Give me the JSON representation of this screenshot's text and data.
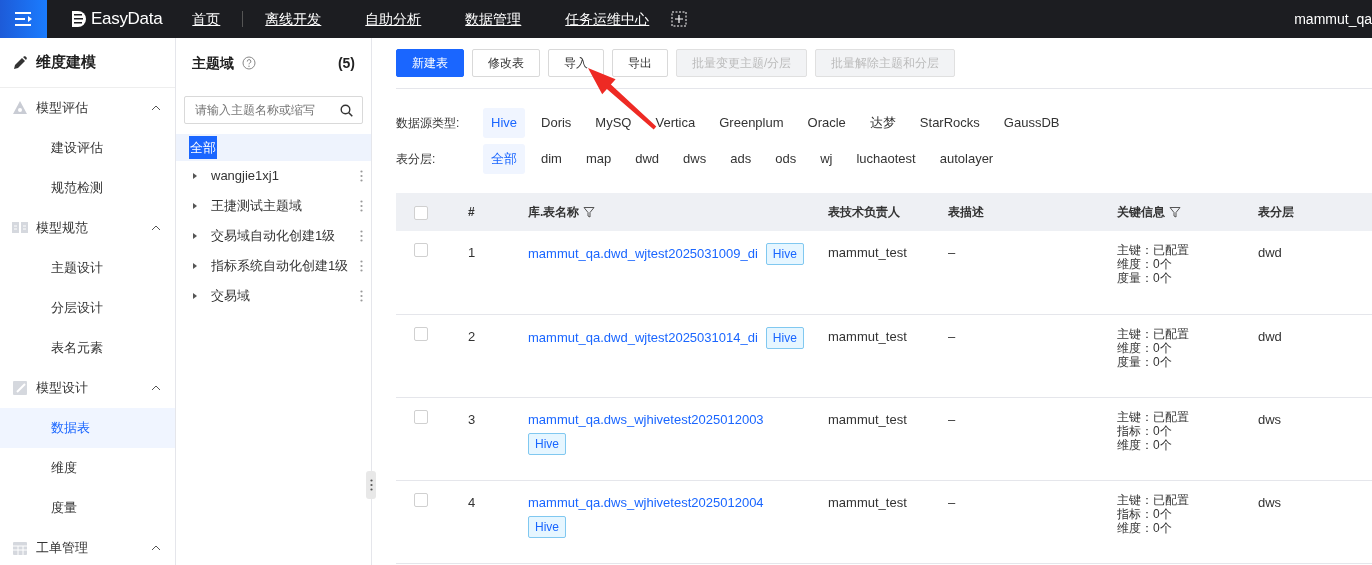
{
  "topbar": {
    "logo": "EasyData",
    "nav": [
      {
        "label": "首页"
      },
      {
        "label": "离线开发"
      },
      {
        "label": "自助分析"
      },
      {
        "label": "数据管理"
      },
      {
        "label": "任务运维中心"
      }
    ],
    "user": "mammut_qa"
  },
  "sidebar": {
    "title": "维度建模",
    "groups": [
      {
        "label": "模型评估",
        "expanded": true,
        "children": [
          {
            "label": "建设评估",
            "selected": false
          },
          {
            "label": "规范检测",
            "selected": false
          }
        ]
      },
      {
        "label": "模型规范",
        "expanded": true,
        "children": [
          {
            "label": "主题设计",
            "selected": false
          },
          {
            "label": "分层设计",
            "selected": false
          },
          {
            "label": "表名元素",
            "selected": false
          }
        ]
      },
      {
        "label": "模型设计",
        "expanded": true,
        "children": [
          {
            "label": "数据表",
            "selected": true
          },
          {
            "label": "维度",
            "selected": false
          },
          {
            "label": "度量",
            "selected": false
          }
        ]
      },
      {
        "label": "工单管理",
        "expanded": true
      }
    ]
  },
  "tree": {
    "title": "主题域",
    "count": "(5)",
    "search": {
      "placeholder": "请输入主题名称或缩写"
    },
    "all": {
      "label": "全部",
      "selected": true
    },
    "items": [
      {
        "label": "wangjie1xj1",
        "expanded": false
      },
      {
        "label": "王捷测试主题域",
        "expanded": false
      },
      {
        "label": "交易域自动化创建1级",
        "expanded": false
      },
      {
        "label": "指标系统自动化创建1级",
        "expanded": false
      },
      {
        "label": "交易域",
        "expanded": false
      }
    ]
  },
  "toolbar": [
    {
      "label": "新建表",
      "kind": "primary",
      "disabled": false
    },
    {
      "label": "修改表",
      "kind": "default",
      "disabled": false
    },
    {
      "label": "导入",
      "kind": "default",
      "disabled": false
    },
    {
      "label": "导出",
      "kind": "default",
      "disabled": false
    },
    {
      "label": "批量变更主题/分层",
      "kind": "default",
      "disabled": true
    },
    {
      "label": "批量解除主题和分层",
      "kind": "default",
      "disabled": true
    }
  ],
  "filters": [
    {
      "label": "数据源类型:",
      "options": [
        {
          "label": "Hive",
          "selected": true
        },
        {
          "label": "Doris",
          "selected": false
        },
        {
          "label": "MySQ",
          "selected": false
        },
        {
          "label": "Vertica",
          "selected": false
        },
        {
          "label": "Greenplum",
          "selected": false
        },
        {
          "label": "Oracle",
          "selected": false
        },
        {
          "label": "达梦",
          "selected": false
        },
        {
          "label": "StarRocks",
          "selected": false
        },
        {
          "label": "GaussDB",
          "selected": false
        }
      ]
    },
    {
      "label": "表分层:",
      "options": [
        {
          "label": "全部",
          "selected": true
        },
        {
          "label": "dim",
          "selected": false
        },
        {
          "label": "map",
          "selected": false
        },
        {
          "label": "dwd",
          "selected": false
        },
        {
          "label": "dws",
          "selected": false
        },
        {
          "label": "ads",
          "selected": false
        },
        {
          "label": "ods",
          "selected": false
        },
        {
          "label": "wj",
          "selected": false
        },
        {
          "label": "luchaotest",
          "selected": false
        },
        {
          "label": "autolayer",
          "selected": false
        }
      ]
    }
  ],
  "table": {
    "select_all": {
      "checked": false
    },
    "columns": [
      {
        "label": "#",
        "filter": false
      },
      {
        "label": "库.表名称",
        "filter": true
      },
      {
        "label": "表技术负责人",
        "filter": false
      },
      {
        "label": "表描述",
        "filter": false
      },
      {
        "label": "关键信息",
        "filter": true
      },
      {
        "label": "表分层",
        "filter": false
      }
    ],
    "rows": [
      {
        "checked": false,
        "index": "1",
        "name": "mammut_qa.dwd_wjtest2025031009_di",
        "tag": "Hive",
        "owner": "mammut_test",
        "description": "–",
        "key_info": [
          "主键：已配置",
          "维度：0个",
          "度量：0个"
        ],
        "layer": "dwd"
      },
      {
        "checked": false,
        "index": "2",
        "name": "mammut_qa.dwd_wjtest2025031014_di",
        "tag": "Hive",
        "owner": "mammut_test",
        "description": "–",
        "key_info": [
          "主键：已配置",
          "维度：0个",
          "度量：0个"
        ],
        "layer": "dwd"
      },
      {
        "checked": false,
        "index": "3",
        "name": "mammut_qa.dws_wjhivetest2025012003",
        "tag": "Hive",
        "owner": "mammut_test",
        "description": "–",
        "key_info": [
          "主键：已配置",
          "指标：0个",
          "维度：0个"
        ],
        "layer": "dws"
      },
      {
        "checked": false,
        "index": "4",
        "name": "mammut_qa.dws_wjhivetest2025012004",
        "tag": "Hive",
        "owner": "mammut_test",
        "description": "–",
        "key_info": [
          "主键：已配置",
          "指标：0个",
          "维度：0个"
        ],
        "layer": "dws"
      }
    ]
  }
}
